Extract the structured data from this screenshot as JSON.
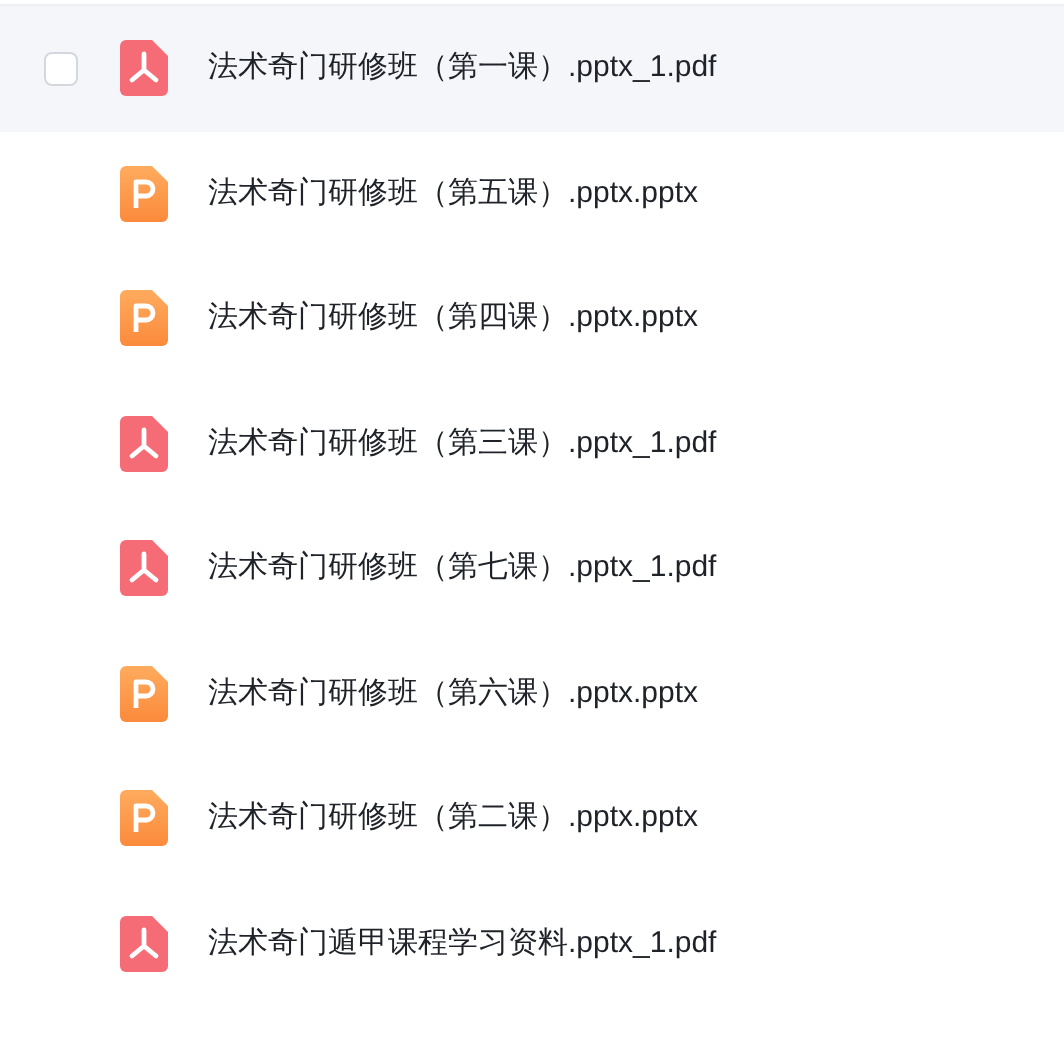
{
  "files": [
    {
      "name": "法术奇门研修班（第一课）.pptx_1.pdf",
      "kind": "pdf",
      "checked": false
    },
    {
      "name": "法术奇门研修班（第五课）.pptx.pptx",
      "kind": "ppt"
    },
    {
      "name": "法术奇门研修班（第四课）.pptx.pptx",
      "kind": "ppt"
    },
    {
      "name": "法术奇门研修班（第三课）.pptx_1.pdf",
      "kind": "pdf"
    },
    {
      "name": "法术奇门研修班（第七课）.pptx_1.pdf",
      "kind": "pdf"
    },
    {
      "name": "法术奇门研修班（第六课）.pptx.pptx",
      "kind": "ppt"
    },
    {
      "name": "法术奇门研修班（第二课）.pptx.pptx",
      "kind": "ppt"
    },
    {
      "name": "法术奇门遁甲课程学习资料.pptx_1.pdf",
      "kind": "pdf"
    }
  ]
}
